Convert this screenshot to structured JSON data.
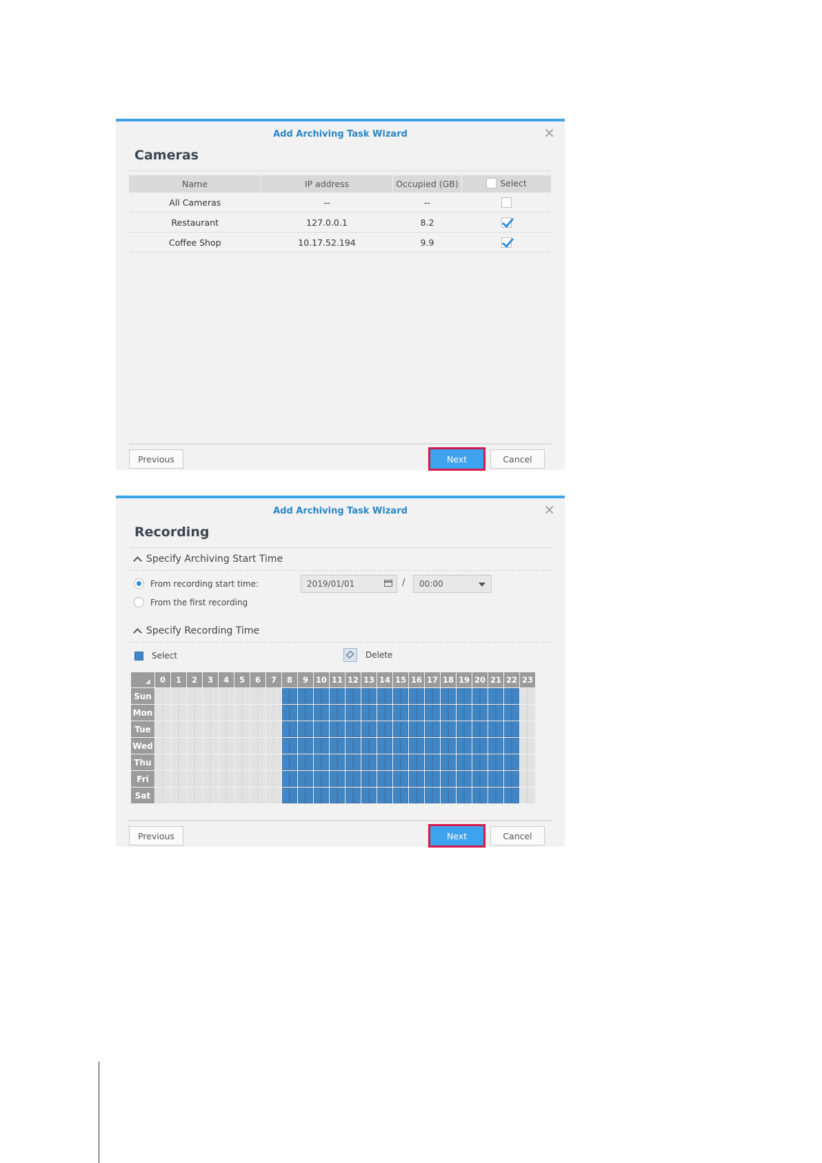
{
  "dialog1": {
    "title": "Add Archiving Task Wizard",
    "section_title": "Cameras",
    "columns": [
      "Name",
      "IP address",
      "Occupied (GB)",
      "Select"
    ],
    "rows": [
      {
        "name": "All Cameras",
        "ip": "--",
        "occupied": "--",
        "selected": false
      },
      {
        "name": "Restaurant",
        "ip": "127.0.0.1",
        "occupied": "8.2",
        "selected": true
      },
      {
        "name": "Coffee Shop",
        "ip": "10.17.52.194",
        "occupied": "9.9",
        "selected": true
      }
    ],
    "buttons": {
      "previous": "Previous",
      "next": "Next",
      "cancel": "Cancel"
    }
  },
  "dialog2": {
    "title": "Add Archiving Task Wizard",
    "section_title": "Recording",
    "start_time_heading": "Specify Archiving Start Time",
    "option_from_start": "From recording start time:",
    "option_first_recording": "From the first recording",
    "selected_option": "from_start",
    "date_value": "2019/01/01",
    "date_separator": "/",
    "time_value": "00:00",
    "recording_heading": "Specify Recording Time",
    "legend_select": "Select",
    "legend_delete": "Delete",
    "schedule": {
      "hours": [
        "0",
        "1",
        "2",
        "3",
        "4",
        "5",
        "6",
        "7",
        "8",
        "9",
        "10",
        "11",
        "12",
        "13",
        "14",
        "15",
        "16",
        "17",
        "18",
        "19",
        "20",
        "21",
        "22",
        "23"
      ],
      "days": [
        "Sun",
        "Mon",
        "Tue",
        "Wed",
        "Thu",
        "Fri",
        "Sat"
      ],
      "selected_from_hour": 8,
      "selected_to_hour": 22
    },
    "buttons": {
      "previous": "Previous",
      "next": "Next",
      "cancel": "Cancel"
    }
  },
  "colors": {
    "accent": "#3da3e8",
    "title_blue": "#2a86c5",
    "selected_cell": "#3f86c6",
    "next_highlight": "#d6194a"
  }
}
